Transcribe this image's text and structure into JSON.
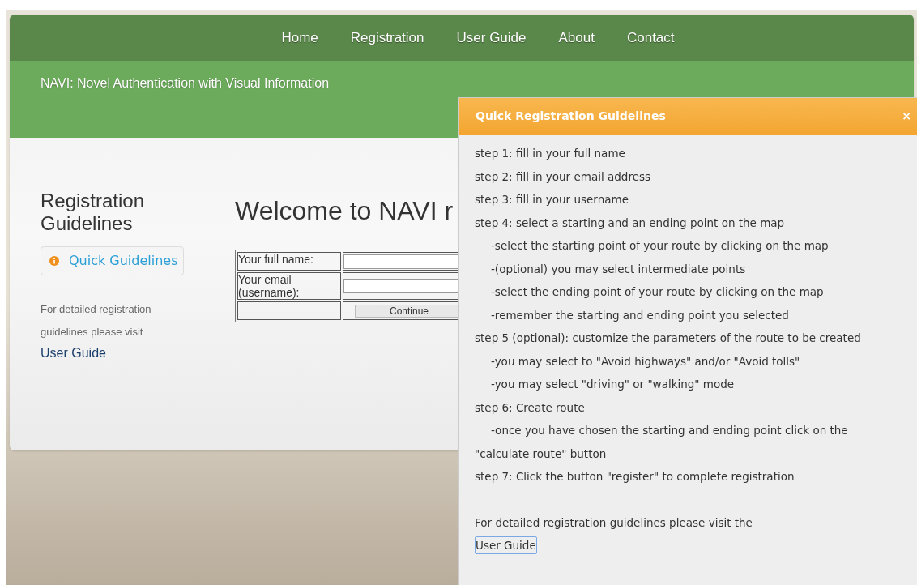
{
  "nav": [
    {
      "label": "Home"
    },
    {
      "label": "Registration"
    },
    {
      "label": "User Guide"
    },
    {
      "label": "About"
    },
    {
      "label": "Contact"
    }
  ],
  "site_title": "NAVI: Novel Authentication with Visual Information",
  "sidebar": {
    "heading": "Registration Guidelines",
    "button": "Quick Guidelines",
    "note": "For detailed registration guidelines please visit",
    "link": "User Guide"
  },
  "main": {
    "heading": "Welcome to NAVI r",
    "form": {
      "rows": [
        {
          "label": "Your full name:"
        },
        {
          "label": "Your email (username):"
        }
      ],
      "button": "Continue"
    }
  },
  "dialog": {
    "title": "Quick Registration Guidelines",
    "close": "×",
    "lines": [
      {
        "kind": "step",
        "text": "step 1: fill in your full name"
      },
      {
        "kind": "step",
        "text": "step 2: fill in your email address"
      },
      {
        "kind": "step",
        "text": "step 3: fill in your username"
      },
      {
        "kind": "step",
        "text": "step 4: select a starting and an ending point on the map"
      },
      {
        "kind": "detail",
        "text": "-select the starting point of your route by clicking on the map"
      },
      {
        "kind": "detail",
        "text": "-(optional) you may select intermediate points"
      },
      {
        "kind": "detail",
        "text": "-select the ending point of your route by clicking on the map"
      },
      {
        "kind": "detail",
        "text": "-remember the starting and ending point you selected"
      },
      {
        "kind": "step",
        "text": "step 5 (optional): customize the parameters of the route to be created"
      },
      {
        "kind": "detail",
        "text": "-you may select to \"Avoid highways\" and/or \"Avoid tolls\""
      },
      {
        "kind": "detail",
        "text": "-you may select \"driving\" or \"walking\" mode"
      },
      {
        "kind": "step",
        "text": "step 6: Create route"
      },
      {
        "kind": "detail",
        "text": "-once you have chosen the starting and ending point click on the"
      },
      {
        "kind": "step",
        "text": "\"calculate route\" button"
      },
      {
        "kind": "step",
        "text": "step 7: Click the button \"register\" to complete registration"
      }
    ],
    "note": "For detailed registration guidelines please visit the",
    "link": "User Guide"
  }
}
